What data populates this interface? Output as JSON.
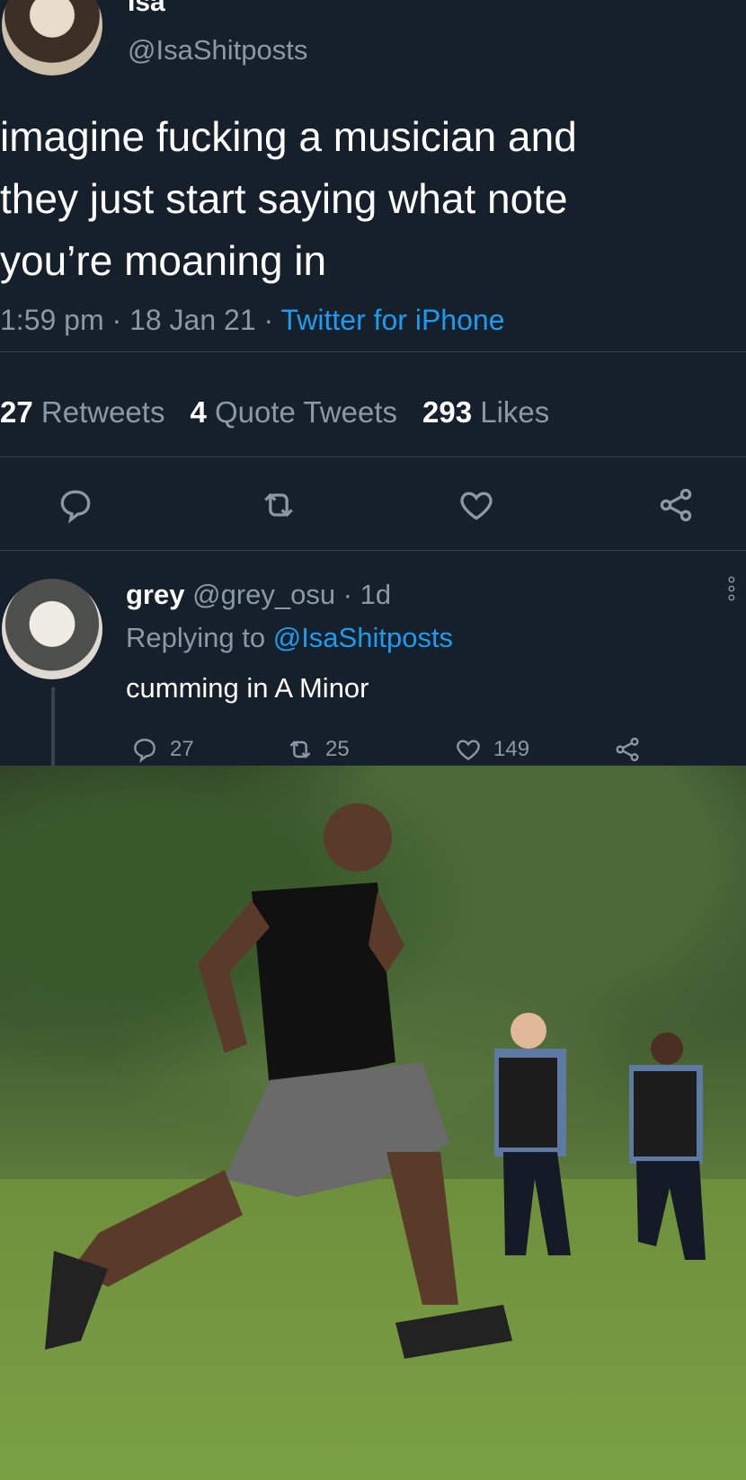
{
  "tweet": {
    "display_name": "Isa",
    "handle": "@IsaShitposts",
    "text": "imagine fucking a musician and\nthey just start saying what note\nyou’re moaning in",
    "time": "1:59 pm · 18 Jan 21 · ",
    "source": "Twitter for iPhone",
    "stats": {
      "retweets_count": "27",
      "retweets_label": "Retweets",
      "quotes_count": "4",
      "quotes_label": "Quote Tweets",
      "likes_count": "293",
      "likes_label": "Likes"
    },
    "actions": [
      "reply-icon",
      "retweet-icon",
      "like-icon",
      "share-icon"
    ]
  },
  "reply": {
    "name": "grey",
    "handle_time": "@grey_osu · 1d",
    "replying_prefix": "Replying to ",
    "replying_mention": "@IsaShitposts",
    "text": "cumming in A Minor",
    "counts": {
      "replies": "27",
      "retweets": "25",
      "likes": "149"
    }
  },
  "colors": {
    "background": "#15202b",
    "accent": "#1d9bf0",
    "secondary_text": "#8b98a5",
    "divider": "#38444d"
  }
}
